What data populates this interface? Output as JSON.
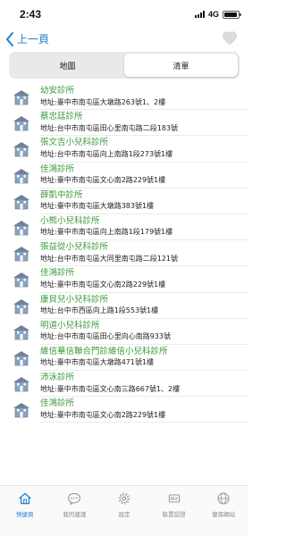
{
  "status_bar": {
    "time": "2:43",
    "network": "4G",
    "battery_level": 0.95
  },
  "nav": {
    "back_label": "上一頁",
    "accent_color": "#1e82d2"
  },
  "segmented_control": {
    "tabs": [
      {
        "label": "地圖",
        "selected": false
      },
      {
        "label": "清單",
        "selected": true
      }
    ]
  },
  "clinics": [
    {
      "name": "幼安診所",
      "address": "地址:臺中市南屯區大墩路263號1、2樓"
    },
    {
      "name": "蔡忠廷診所",
      "address": "地址:台中市南屯區田心里南屯路二段183號"
    },
    {
      "name": "張文吉小兒科診所",
      "address": "地址:台中市南屯區向上南路1段273號1樓"
    },
    {
      "name": "佳鴻診所",
      "address": "地址:臺中市南屯區文心南2路229號1樓"
    },
    {
      "name": "薛凱中診所",
      "address": "地址:臺中市南屯區大墩路383號1樓"
    },
    {
      "name": "小熊小兒科診所",
      "address": "地址:臺中市南屯區向上南路1段179號1樓"
    },
    {
      "name": "張益從小兒科診所",
      "address": "地址:台中市南屯區大同里南屯路二段121號"
    },
    {
      "name": "佳鴻診所",
      "address": "地址:臺中市南屯區文心南2路229號1樓"
    },
    {
      "name": "康貝兒小兒科診所",
      "address": "地址:台中市西區向上路1段553號1樓"
    },
    {
      "name": "明道小兒科診所",
      "address": "地址:台中市南屯區田心里向心南路933號"
    },
    {
      "name": "維信華信聯合門診維信小兒科診所",
      "address": "地址:臺中市南屯區大墩路471號1樓"
    },
    {
      "name": "沛泳診所",
      "address": "地址:臺中市南屯區文心南三路667號1、2樓"
    },
    {
      "name": "佳鴻診所",
      "address": "地址:臺中市南屯區文心南2路229號1樓"
    }
  ],
  "colors": {
    "clinic_name": "#3c9a3c",
    "active_tab": "#1e82d2",
    "inactive_tab": "#888888"
  },
  "tab_bar": {
    "tabs": [
      {
        "label": "快捷頁",
        "icon": "home-icon",
        "active": true
      },
      {
        "label": "我的建議",
        "icon": "chat-bubble-icon",
        "active": false
      },
      {
        "label": "設定",
        "icon": "gear-icon",
        "active": false
      },
      {
        "label": "裝置認證",
        "icon": "device-icon",
        "active": false
      },
      {
        "label": "健保網站",
        "icon": "globe-icon",
        "active": false
      }
    ]
  }
}
